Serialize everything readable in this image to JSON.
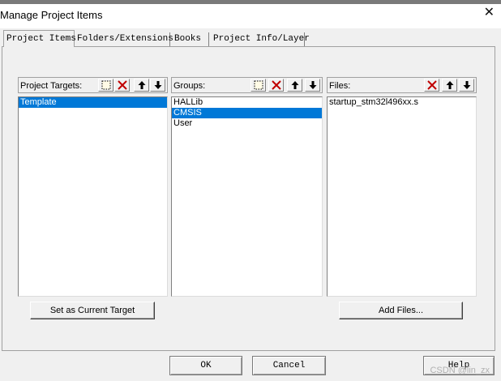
{
  "window": {
    "title": "Manage Project Items",
    "close_icon": "close-icon"
  },
  "tabs": [
    {
      "label": "Project Items",
      "active": true
    },
    {
      "label": "Folders/Extensions",
      "active": false
    },
    {
      "label": "Books",
      "active": false
    },
    {
      "label": "Project Info/Layer",
      "active": false
    }
  ],
  "targets": {
    "label": "Project Targets:",
    "items": [
      {
        "name": "Template",
        "selected": true
      }
    ],
    "toolbar_icons": [
      "new-icon",
      "delete-icon",
      "move-up-icon",
      "move-down-icon"
    ],
    "action_label": "Set as Current Target"
  },
  "groups": {
    "label": "Groups:",
    "items": [
      {
        "name": "HALLib",
        "selected": false
      },
      {
        "name": "CMSIS",
        "selected": true
      },
      {
        "name": "User",
        "selected": false
      }
    ],
    "toolbar_icons": [
      "new-icon",
      "delete-icon",
      "move-up-icon",
      "move-down-icon"
    ]
  },
  "files": {
    "label": "Files:",
    "items": [
      {
        "name": "startup_stm32l496xx.s",
        "selected": false
      }
    ],
    "toolbar_icons": [
      "delete-icon",
      "move-up-icon",
      "move-down-icon"
    ],
    "action_label": "Add Files..."
  },
  "footer": {
    "ok_label": "OK",
    "cancel_label": "Cancel",
    "help_label": "Help"
  },
  "watermark": "CSDN @lin_zx",
  "colors": {
    "selection": "#0078d7",
    "delete_red": "#c00000"
  }
}
